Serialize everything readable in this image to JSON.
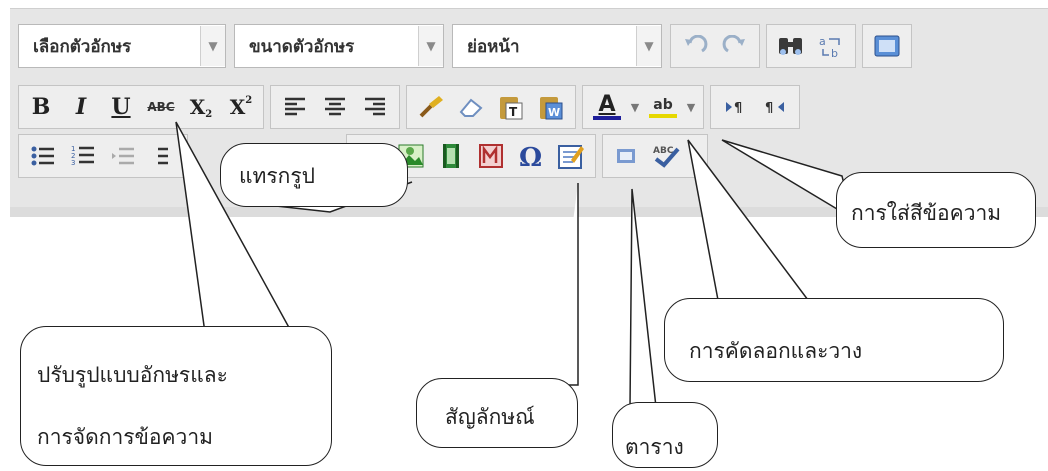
{
  "toolbar": {
    "font_select": "เลือกตัวอักษร",
    "size_select": "ขนาดตัวอักษร",
    "indent_select": "ย่อหน้า",
    "bold": "B",
    "italic": "I",
    "underline": "U",
    "strike": "ABC",
    "subscript": "X",
    "superscript": "X",
    "font_color": "A",
    "highlight": "ab"
  },
  "callouts": {
    "insert_image": "แทรกรูป",
    "font_color": "การใส่สีข้อความ",
    "text_format_1": "ปรับรูปแบบอักษรและ",
    "text_format_2": "การจัดการข้อความ",
    "cut_paste": "การคัดลอกและวาง",
    "symbol": "สัญลักษณ์",
    "table": "ตาราง"
  },
  "icons": [
    "dropdown-arrow-icon",
    "undo-icon",
    "redo-icon",
    "find-icon",
    "replace-icon",
    "source-icon",
    "bold-icon",
    "italic-icon",
    "underline-icon",
    "strikethrough-icon",
    "subscript-icon",
    "superscript-icon",
    "align-left-icon",
    "align-center-icon",
    "align-right-icon",
    "clean-icon",
    "eraser-icon",
    "paste-text-icon",
    "paste-word-icon",
    "font-color-icon",
    "highlight-icon",
    "ltr-icon",
    "rtl-icon",
    "bullet-list-icon",
    "numbered-list-icon",
    "outdent-icon",
    "unlink-icon",
    "image-icon",
    "flash-icon",
    "pagebreak-icon",
    "omega-icon",
    "table-icon",
    "template-icon",
    "spellcheck-icon"
  ],
  "colors": {
    "font_color_bar": "#1e1e9a",
    "highlight_bar": "#e6d800",
    "image_green": "#2a8a2a"
  }
}
